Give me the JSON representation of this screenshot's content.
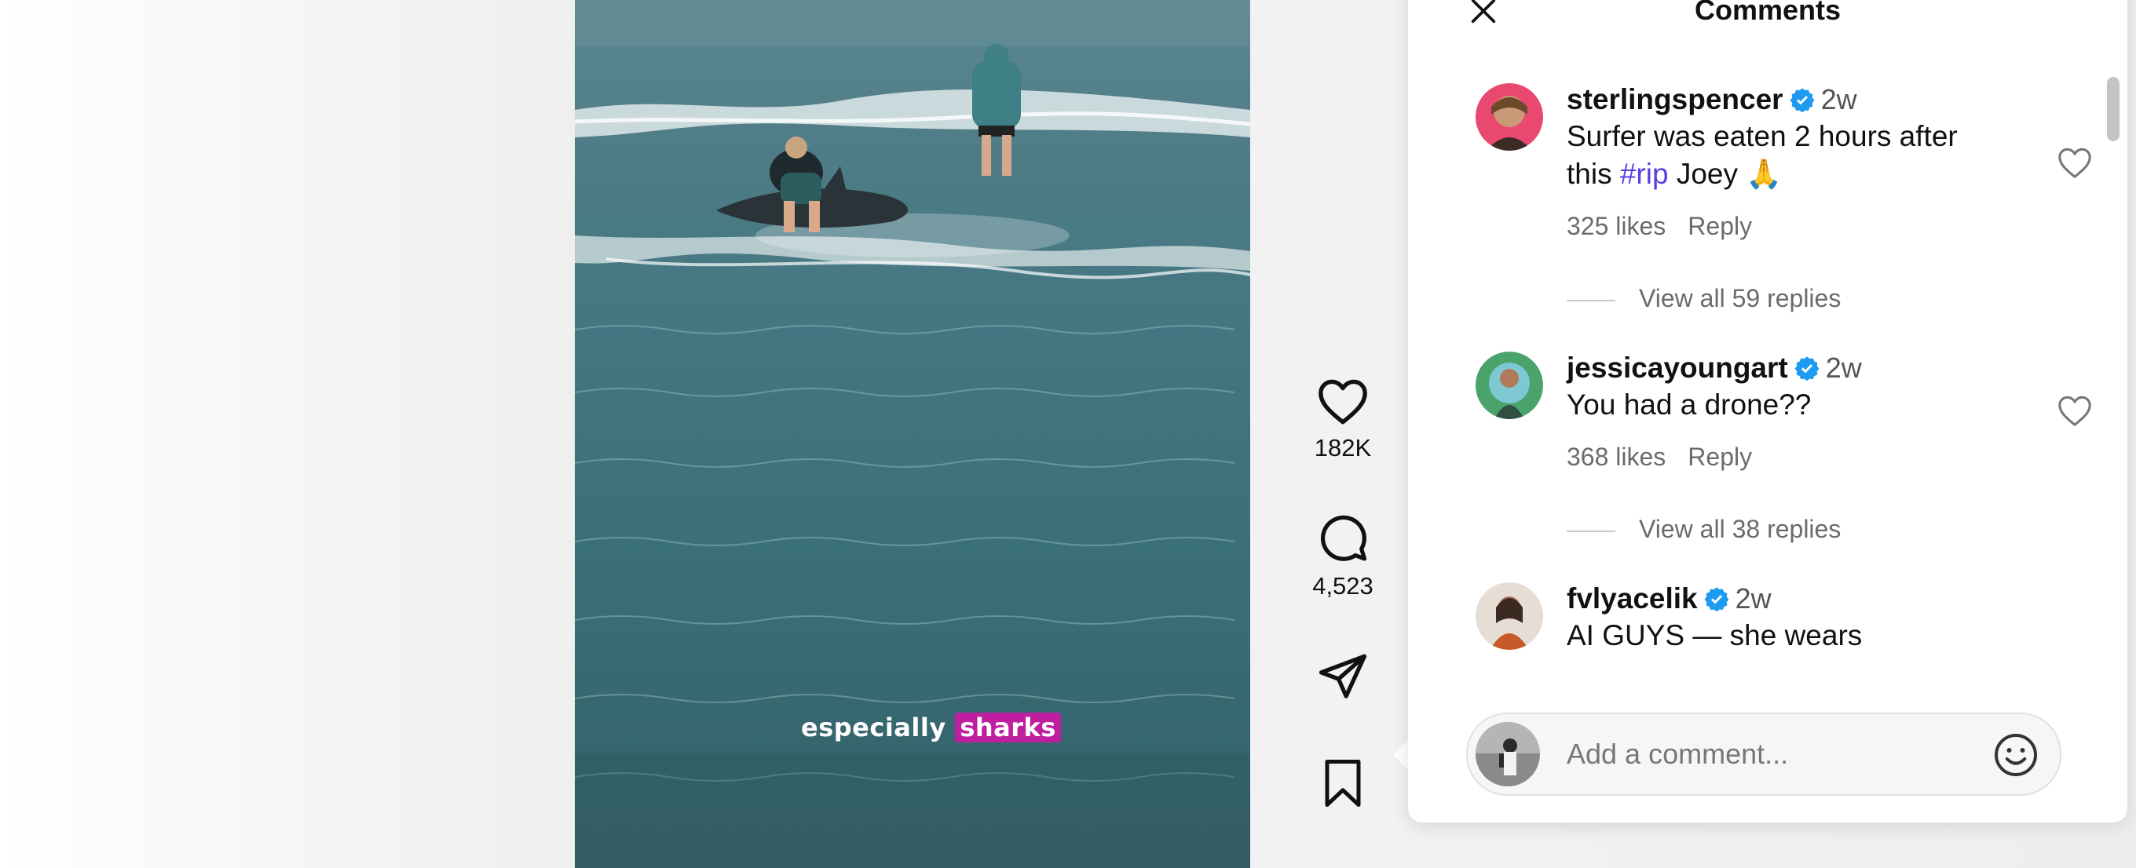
{
  "video": {
    "caption_plain": "especially",
    "caption_highlight": "sharks",
    "highlight_color": "#c01ea0"
  },
  "actions": {
    "like": {
      "icon": "heart-icon",
      "count": "182K"
    },
    "comment": {
      "icon": "comment-icon",
      "count": "4,523"
    },
    "share": {
      "icon": "send-icon"
    },
    "save": {
      "icon": "bookmark-icon"
    }
  },
  "comments_panel": {
    "title": "Comments",
    "close_icon": "close-icon",
    "comments": [
      {
        "username": "sterlingspencer",
        "verified": true,
        "time": "2w",
        "text_line1": "Surfer was eaten 2 hours after",
        "text_line2_pre": "this ",
        "hashtag": "#rip",
        "text_line2_post": " Joey 🙏",
        "likes": "325 likes",
        "reply": "Reply",
        "view_replies": "View all 59 replies"
      },
      {
        "username": "jessicayoungart",
        "verified": true,
        "time": "2w",
        "text_line1": "You had a drone??",
        "likes": "368 likes",
        "reply": "Reply",
        "view_replies": "View all 38 replies"
      },
      {
        "username": "fvlyacelik",
        "verified": true,
        "time": "2w",
        "text_line1": "AI GUYS — she wears"
      }
    ],
    "input": {
      "placeholder": "Add a comment..."
    },
    "hashtag_color": "#5a3fe0",
    "verified_color": "#1d9bf0"
  }
}
